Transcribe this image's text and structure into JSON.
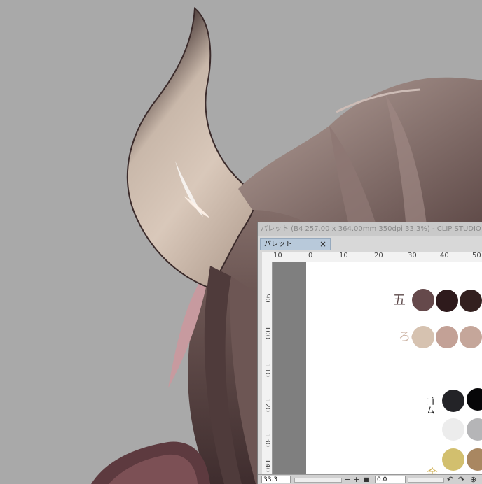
{
  "window": {
    "title": "パレット (B4 257.00 x 364.00mm 350dpi 33.3%)  - CLIP STUDIO",
    "tab_label": "パレット",
    "tab_close": "×"
  },
  "ruler": {
    "horizontal": [
      "10",
      "0",
      "10",
      "20",
      "30",
      "40",
      "50"
    ],
    "vertical": [
      "90",
      "100",
      "110",
      "120",
      "130",
      "140"
    ]
  },
  "palette_labels": {
    "row1": "五",
    "row2": "ろの",
    "row3": "ゴム",
    "row4": "金"
  },
  "swatch_colors": {
    "row1": [
      "#65494b",
      "#2e1a1c",
      "#33201f"
    ],
    "row2": [
      "#d6c2b0",
      "#c3a196",
      "#c5a69a"
    ],
    "row3": [
      "#232327",
      "#060608"
    ],
    "row4_gray": [
      "#ececec",
      "#b5b5b7"
    ],
    "row5": [
      "#d2bf6e",
      "#a98761"
    ]
  },
  "status_bar": {
    "zoom_value": "33.3",
    "zoom_out": "−",
    "zoom_in": "+",
    "fit": "■",
    "angle_value": "0.0",
    "rotate_left": "↶",
    "rotate_right": "↷",
    "reset": "⊕"
  },
  "colors": {
    "background": "#a9a9a9",
    "tab_active": "#b8c9da",
    "ruler": "#f2f2f2"
  }
}
